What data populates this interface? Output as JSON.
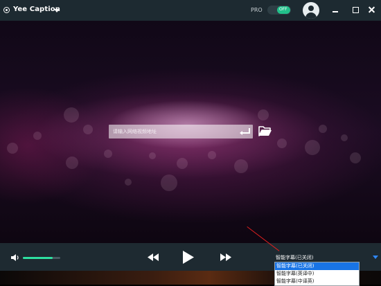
{
  "app": {
    "title": "Yee Caption"
  },
  "header": {
    "pro_label": "PRO",
    "pro_toggle_state": "OFF"
  },
  "url_bar": {
    "placeholder": "请输入网络视频地址"
  },
  "player": {
    "volume_level": 0.8
  },
  "subtitle": {
    "current": "智能字幕(已关闭)",
    "options": [
      "智能字幕(已关闭)",
      "智能字幕(英译中)",
      "智能字幕(中译英)"
    ],
    "selected_index": 0
  },
  "colors": {
    "accent": "#22c08a",
    "selection": "#1874e6",
    "titlebar": "#1d2a31"
  },
  "icons": [
    "logo-icon",
    "caret-down-icon",
    "user-avatar-icon",
    "minimize-icon",
    "maximize-icon",
    "close-icon",
    "enter-icon",
    "folder-open-icon",
    "volume-icon",
    "rewind-icon",
    "play-icon",
    "fast-forward-icon",
    "chevron-down-icon"
  ]
}
